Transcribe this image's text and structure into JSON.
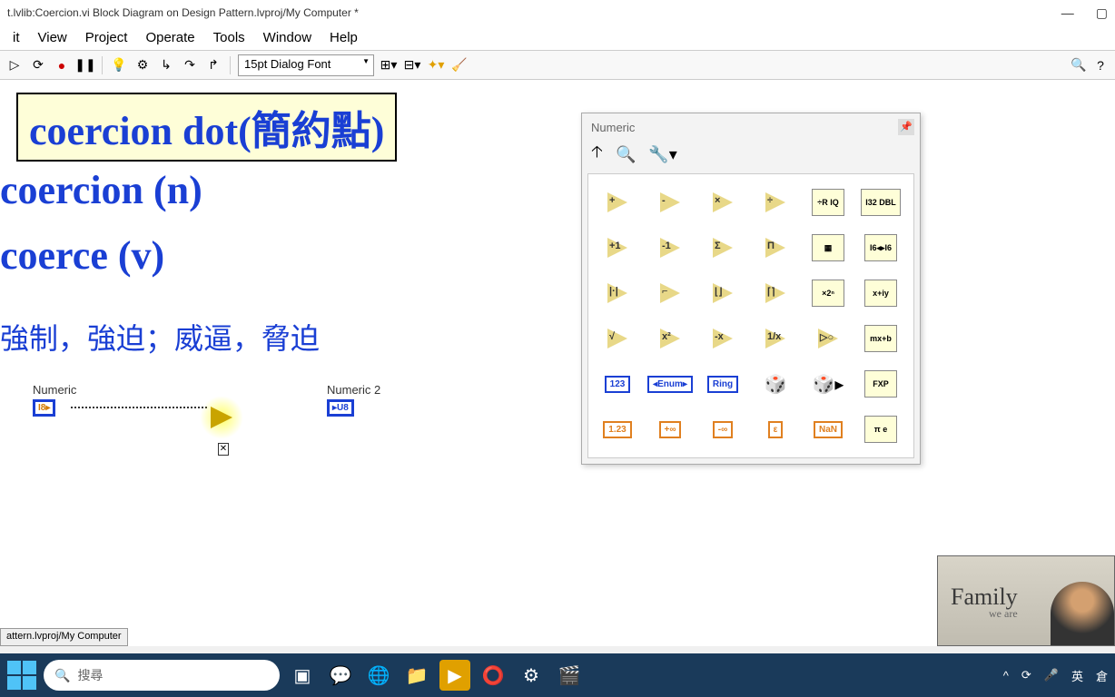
{
  "window": {
    "title": "t.lvlib:Coercion.vi Block Diagram on Design Pattern.lvproj/My Computer *"
  },
  "menu": {
    "items": [
      "it",
      "View",
      "Project",
      "Operate",
      "Tools",
      "Window",
      "Help"
    ]
  },
  "toolbar": {
    "font": "15pt Dialog Font"
  },
  "content": {
    "title_box": "coercion dot(簡約點)",
    "line1": "coercion (n)",
    "line2": "coerce (v)",
    "line3": "強制，強迫；威逼，脅迫",
    "numeric_label": "Numeric",
    "numeric_type": "I8▸",
    "numeric2_label": "Numeric 2",
    "numeric2_type": "▸U8"
  },
  "palette": {
    "title": "Numeric",
    "items": [
      {
        "sym": "+",
        "type": "tri"
      },
      {
        "sym": "-",
        "type": "tri"
      },
      {
        "sym": "×",
        "type": "tri"
      },
      {
        "sym": "÷",
        "type": "tri"
      },
      {
        "sym": "÷R\nIQ",
        "type": "sub"
      },
      {
        "sym": "I32\nDBL",
        "type": "sub"
      },
      {
        "sym": "+1",
        "type": "tri"
      },
      {
        "sym": "-1",
        "type": "tri"
      },
      {
        "sym": "Σ",
        "type": "tri"
      },
      {
        "sym": "Π",
        "type": "tri"
      },
      {
        "sym": "▦",
        "type": "sub"
      },
      {
        "sym": "I6◂▸I6",
        "type": "sub"
      },
      {
        "sym": "|·|",
        "type": "tri"
      },
      {
        "sym": "⌐",
        "type": "tri"
      },
      {
        "sym": "⌊⌋",
        "type": "tri"
      },
      {
        "sym": "⌈⌉",
        "type": "tri"
      },
      {
        "sym": "×2ⁿ",
        "type": "sub"
      },
      {
        "sym": "x+iy",
        "type": "sub"
      },
      {
        "sym": "√",
        "type": "tri"
      },
      {
        "sym": "x²",
        "type": "tri"
      },
      {
        "sym": "-x",
        "type": "tri"
      },
      {
        "sym": "1/x",
        "type": "tri"
      },
      {
        "sym": "▷○",
        "type": "tri"
      },
      {
        "sym": "mx+b",
        "type": "sub"
      },
      {
        "sym": "123",
        "type": "rect-blue"
      },
      {
        "sym": "◂Enum▸",
        "type": "rect-blue"
      },
      {
        "sym": "Ring",
        "type": "rect-blue"
      },
      {
        "sym": "🎲",
        "type": "plain"
      },
      {
        "sym": "🎲▸",
        "type": "plain"
      },
      {
        "sym": "FXP",
        "type": "sub"
      },
      {
        "sym": "1.23",
        "type": "rect-orange"
      },
      {
        "sym": "+∞",
        "type": "rect-orange"
      },
      {
        "sym": "-∞",
        "type": "rect-orange"
      },
      {
        "sym": "ε",
        "type": "rect-orange"
      },
      {
        "sym": "NaN",
        "type": "rect-orange"
      },
      {
        "sym": "π\ne",
        "type": "sub"
      }
    ]
  },
  "status": {
    "bottom": "attern.lvproj/My Computer"
  },
  "taskbar": {
    "search_placeholder": "搜尋",
    "tray": {
      "ime1": "英",
      "ime2": "倉"
    }
  },
  "webcam": {
    "family": "Family",
    "weare": "we are"
  }
}
